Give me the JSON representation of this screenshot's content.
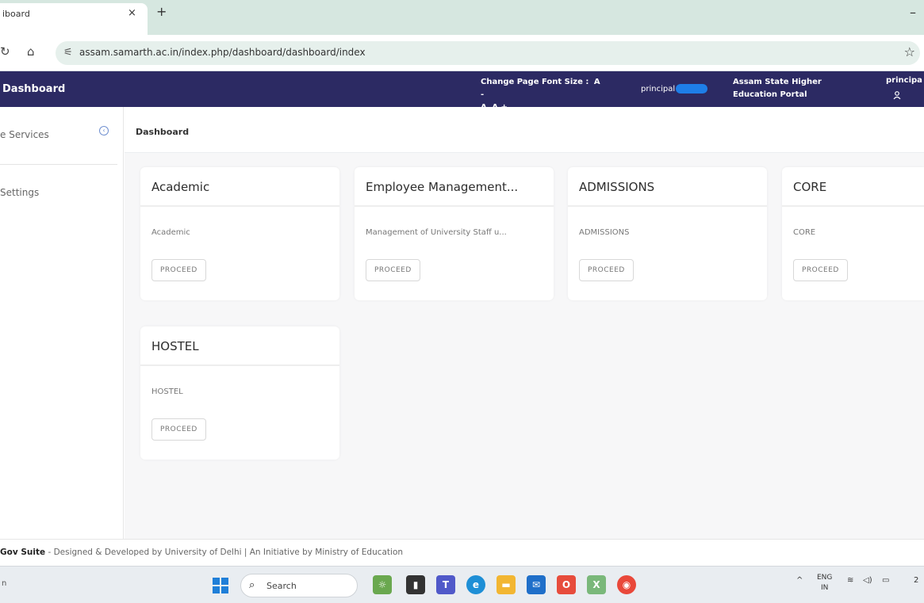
{
  "browser": {
    "tab_title": "iboard",
    "tab_close": "×",
    "new_tab": "+",
    "minimize": "–",
    "back": "↻",
    "home": "⌂",
    "url": "assam.samarth.ac.in/index.php/dashboard/dashboard/index"
  },
  "header": {
    "app_title": "Dashboard",
    "font_size_label": "Change Page Font Size :",
    "font_decrease": "A -",
    "font_normal": "A",
    "font_increase": "A +",
    "user_name": "principal",
    "portal_name": "Assam State Higher Education Portal",
    "user_menu": "principa"
  },
  "sidebar": {
    "items": [
      {
        "label": "e Services"
      },
      {
        "label": "Settings"
      }
    ]
  },
  "main": {
    "breadcrumb": "Dashboard",
    "cards": [
      {
        "title": "Academic",
        "description": "Academic",
        "button": "PROCEED"
      },
      {
        "title": "Employee Management...",
        "description": "Management of University Staff u...",
        "button": "PROCEED"
      },
      {
        "title": "ADMISSIONS",
        "description": "ADMISSIONS",
        "button": "PROCEED"
      },
      {
        "title": "CORE",
        "description": "CORE",
        "button": "PROCEED"
      },
      {
        "title": "HOSTEL",
        "description": "HOSTEL",
        "button": "PROCEED"
      }
    ]
  },
  "footer": {
    "brand": "Gov Suite",
    "text": " - Designed & Developed by University of Delhi | An Initiative by Ministry of Education"
  },
  "taskbar": {
    "left_text": "n",
    "search_placeholder": "Search",
    "lang_top": "ENG",
    "lang_bottom": "IN",
    "clock_partial": "2"
  },
  "colors": {
    "header_bg": "#2c2a63",
    "tab_strip_bg": "#d6e7e0",
    "content_bg": "#f7f7f8",
    "redaction": "#1e7ee8"
  }
}
